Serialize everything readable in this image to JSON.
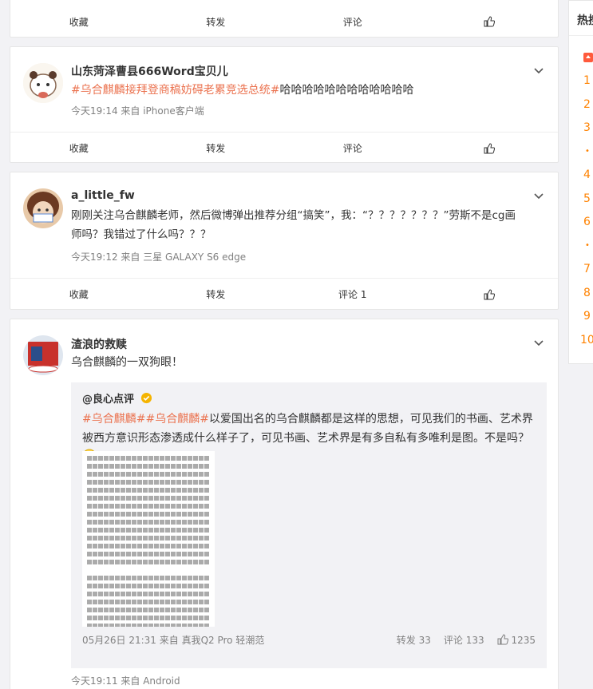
{
  "colors": {
    "tag": "#eb7350",
    "rank": "#ff8200",
    "meta": "#808080"
  },
  "posts": [
    {
      "actions": {
        "fav": "收藏",
        "repost": "转发",
        "comment": "评论"
      }
    },
    {
      "user": "山东菏泽曹县666Word宝贝儿",
      "tag": "#乌合麒麟接拜登商稿妨碍老累竞选总统#",
      "text": "哈哈哈哈哈哈哈哈哈哈哈哈",
      "meta": "今天19:14  来自 iPhone客户端",
      "actions": {
        "fav": "收藏",
        "repost": "转发",
        "comment": "评论"
      }
    },
    {
      "user": "a_little_fw",
      "text_line1": "刚刚关注乌合麒麟老师，然后微博弹出推荐分组“搞笑”，我：“？？？？？？？”劳斯不是cg画",
      "text_line2": "师吗？我错过了什么吗？？？",
      "meta": "今天19:12  来自 三星 GALAXY S6 edge",
      "actions": {
        "fav": "收藏",
        "repost": "转发",
        "comment": "评论 1"
      }
    },
    {
      "user": "渣浪的救赎",
      "text": "乌合麒麟的一双狗眼！",
      "meta": "今天19:11  来自 Android",
      "repost": {
        "user": "@良心点评",
        "tags": "#乌合麒麟##乌合麒麟#",
        "text": "以爱国出名的乌合麒麟都是这样的思想，可见我们的书画、艺术界被西方意识形态渗透成什么样子了，可见书画、艺术界是有多自私有多唯利是图。不是吗？",
        "meta": "05月26日 21:31 来自 真我Q2 Pro 轻潮范",
        "reposts": "转发 33",
        "comments": "评论 133",
        "likes": "1235"
      }
    }
  ],
  "sidebar": {
    "title": "热搜",
    "ranks": [
      "top",
      "1",
      "2",
      "3",
      "•",
      "4",
      "5",
      "6",
      "•",
      "7",
      "8",
      "9",
      "10"
    ]
  }
}
